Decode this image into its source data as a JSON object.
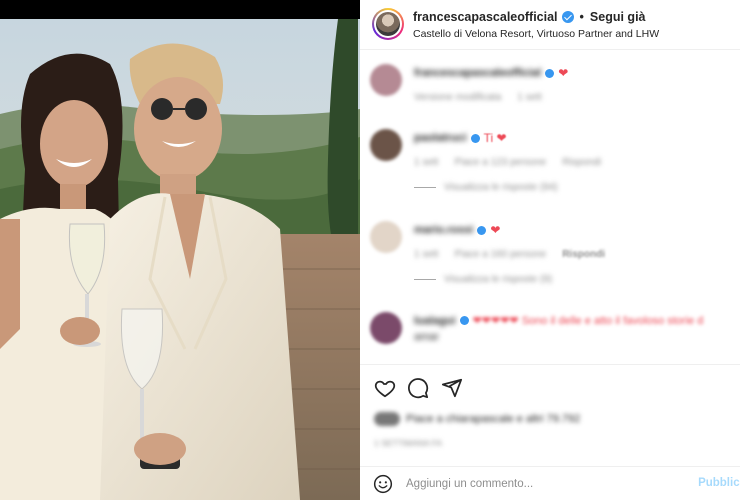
{
  "post": {
    "username": "francescapascaleofficial",
    "separator": "•",
    "follow_label": "Segui già",
    "location": "Castello di Velona Resort, Virtuoso Partner and LHW",
    "photo_alt": "Francesca Pascale e Paola Turci in abito bianco con calici di vino"
  },
  "comments": [
    {
      "user": "francescapascaleofficial",
      "text": "❤",
      "meta": [
        "Versione modificata",
        "1 sett"
      ],
      "reply_label": "",
      "avatar_color": "#b58a94"
    },
    {
      "user": "paolatruci",
      "text": "Ti ❤",
      "meta": [
        "1 sett",
        "Piace a 123 persone",
        "Rispondi"
      ],
      "reply_label": "Visualizza le risposte (94)",
      "avatar_color": "#6b5448"
    },
    {
      "user": "mario.rossi",
      "text": "❤",
      "meta": [
        "1 sett",
        "Piace a 160 persone",
        "Rispondi"
      ],
      "reply_label": "Visualizza le risposte (9)",
      "avatar_color": "#e2d5c8"
    },
    {
      "user": "lualagui",
      "text": "❤❤❤❤❤ Sono il delle e atto il favoloso storie d",
      "text2": "amar",
      "meta": [],
      "reply_label": "",
      "avatar_color": "#7b4a6a"
    }
  ],
  "actions": {
    "like": "heart-icon",
    "comment": "comment-icon",
    "share": "share-icon"
  },
  "likes_text": "Piace a chiarapascale e altri 79.792",
  "date_text": "1 SETTIMANA FA",
  "composer": {
    "placeholder": "Aggiungi un commento...",
    "publish_label": "Pubblica"
  },
  "colors": {
    "verified": "#3897f0",
    "heart": "#ed4956",
    "publish": "#0095f6"
  }
}
